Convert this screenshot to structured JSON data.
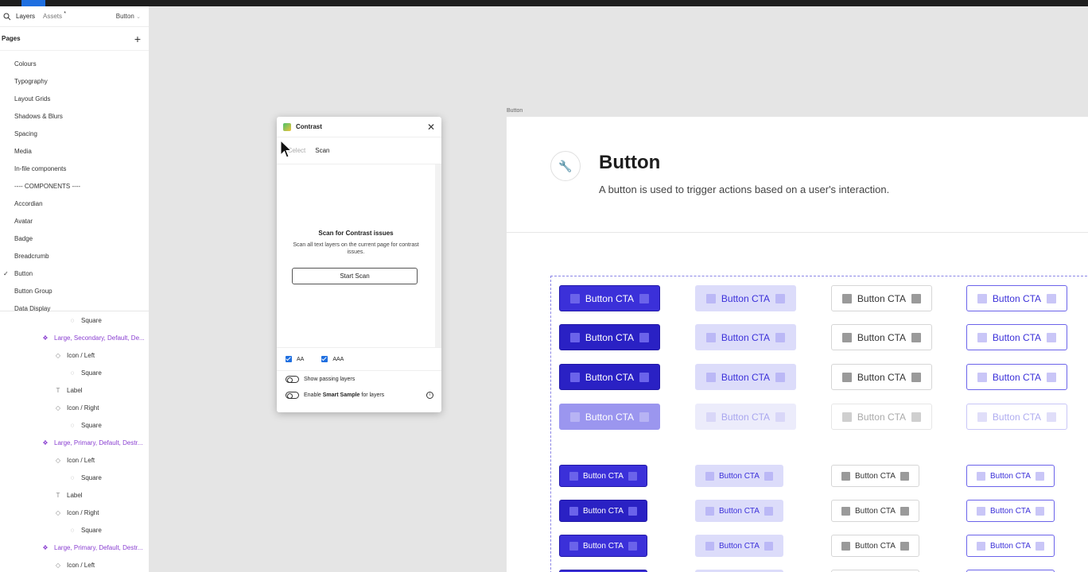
{
  "panel": {
    "tabs": {
      "layers": "Layers",
      "assets": "Assets",
      "assets_dot": "*",
      "page_selector": "Button"
    },
    "pages_title": "Pages",
    "pages": [
      "Colours",
      "Typography",
      "Layout Grids",
      "Shadows & Blurs",
      "Spacing",
      "Media",
      "In-file components",
      "---- COMPONENTS ----",
      "Accordian",
      "Avatar",
      "Badge",
      "Breadcrumb",
      "Button",
      "Button Group",
      "Data Display"
    ],
    "current_page_check": "✓",
    "layers": [
      {
        "label": "Square"
      },
      {
        "label": "Large, Secondary, Default, De..."
      },
      {
        "label": "Icon / Left"
      },
      {
        "label": "Square"
      },
      {
        "label": "Label"
      },
      {
        "label": "Icon / Right"
      },
      {
        "label": "Square"
      },
      {
        "label": "Large, Primary, Default, Destr..."
      },
      {
        "label": "Icon / Left"
      },
      {
        "label": "Square"
      },
      {
        "label": "Label"
      },
      {
        "label": "Icon / Right"
      },
      {
        "label": "Square"
      },
      {
        "label": "Large, Primary, Default, Destr..."
      },
      {
        "label": "Icon / Left"
      }
    ]
  },
  "plugin": {
    "title": "Contrast",
    "tab_select": "Select",
    "tab_scan": "Scan",
    "heading": "Scan for Contrast issues",
    "description": "Scan all text layers on the current page for contrast issues.",
    "start_button": "Start Scan",
    "check_aa": "AA",
    "check_aaa": "AAA",
    "toggle_passing": "Show passing layers",
    "toggle_smart_prefix": "Enable ",
    "toggle_smart_bold": "Smart Sample",
    "toggle_smart_suffix": " for layers"
  },
  "frame": {
    "label": "Button",
    "title": "Button",
    "description": "A button is used to trigger actions based on a user's interaction.",
    "button_label": "Button CTA"
  },
  "colors": {
    "primary": "#3b30d9",
    "secondary_bg": "#dcdcfa",
    "accent_blue": "#1f6fe0",
    "purple_layer": "#8a3fd1"
  }
}
